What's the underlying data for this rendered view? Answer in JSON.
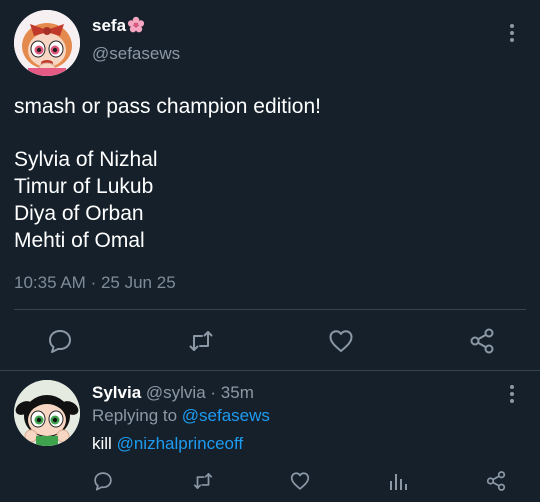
{
  "tweet": {
    "display_name": "sefa",
    "name_emoji": "cherry-blossom-emoji",
    "handle": "@sefasews",
    "text_line1": "smash or pass champion edition!",
    "list": [
      "Sylvia of Nizhal",
      "Timur of Lukub",
      "Diya of Orban",
      "Mehti of Omal"
    ],
    "time": "10:35 AM",
    "separator": "·",
    "date": "25 Jun 25"
  },
  "reply": {
    "display_name": "Sylvia",
    "handle": "@sylvia",
    "separator": "·",
    "age": "35m",
    "replying_to_label": "Replying to",
    "replying_to_handle": "@sefasews",
    "text_prefix": "kill",
    "mention": "@nizhalprinceoff"
  },
  "colors": {
    "background": "#15202b",
    "secondary_text": "#8b98a5",
    "link": "#1d9bf0",
    "divider": "#38444d",
    "icon": "#8b98a5"
  },
  "icons": {
    "tweet_actions": [
      "reply-icon",
      "retweet-icon",
      "like-icon",
      "share-icon"
    ],
    "reply_actions": [
      "reply-icon",
      "retweet-icon",
      "like-icon",
      "analytics-icon",
      "share-icon"
    ],
    "menu": "more-icon"
  }
}
